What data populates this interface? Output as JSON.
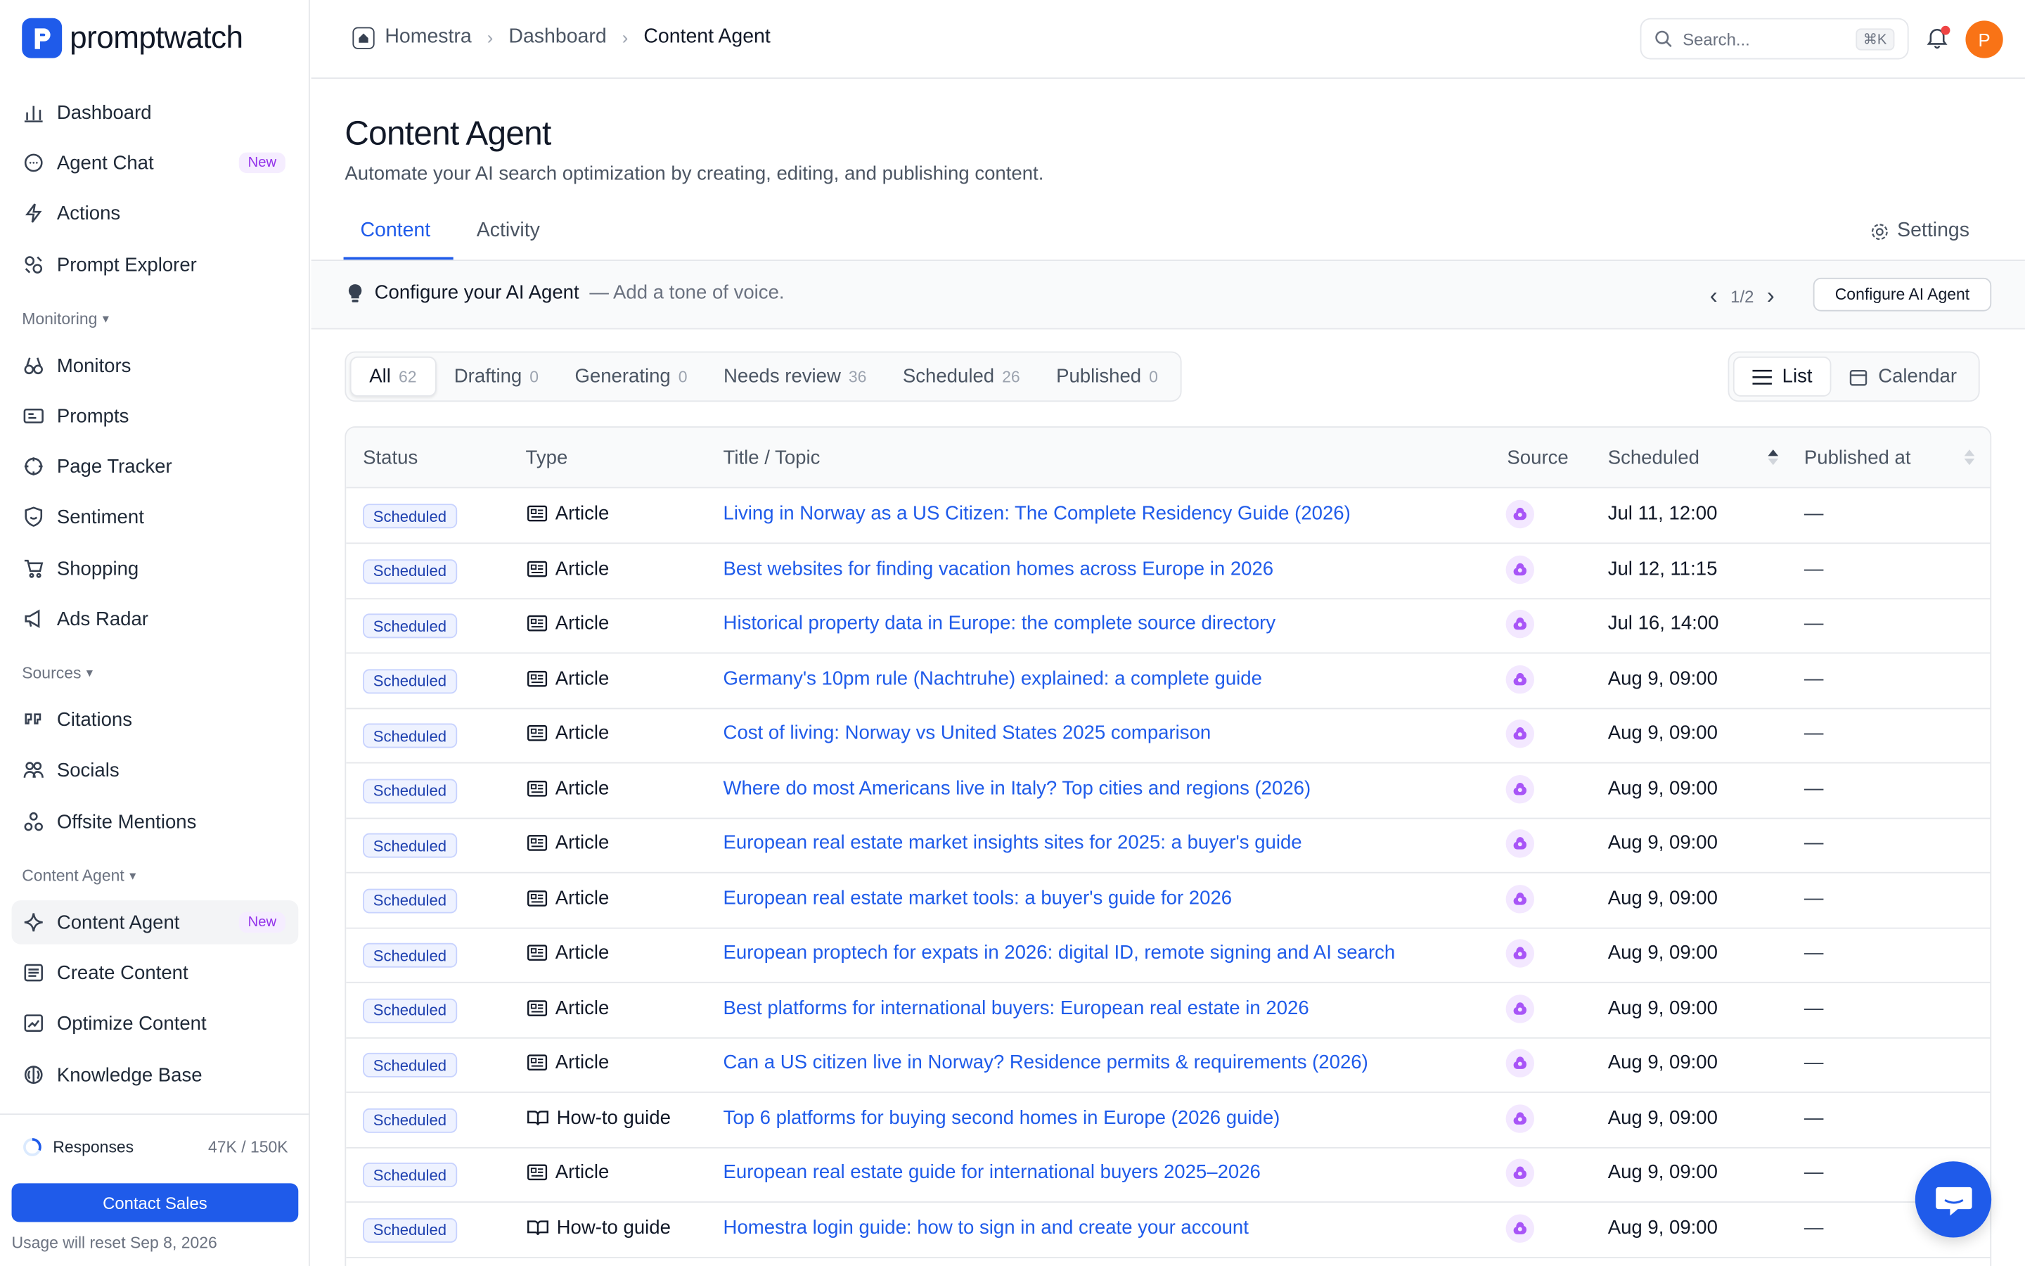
{
  "app": {
    "name": "promptwatch"
  },
  "sidebar": {
    "top_items": [
      {
        "label": "Dashboard",
        "icon": "bar-chart-icon"
      },
      {
        "label": "Agent Chat",
        "icon": "chat-icon",
        "badge": "New"
      },
      {
        "label": "Actions",
        "icon": "bolt-icon"
      },
      {
        "label": "Prompt Explorer",
        "icon": "explorer-icon"
      }
    ],
    "monitoring_label": "Monitoring",
    "monitoring_items": [
      {
        "label": "Monitors",
        "icon": "binoculars-icon"
      },
      {
        "label": "Prompts",
        "icon": "prompts-icon"
      },
      {
        "label": "Page Tracker",
        "icon": "crosshair-icon"
      },
      {
        "label": "Sentiment",
        "icon": "shield-smile-icon"
      },
      {
        "label": "Shopping",
        "icon": "cart-icon"
      },
      {
        "label": "Ads Radar",
        "icon": "megaphone-icon"
      }
    ],
    "sources_label": "Sources",
    "sources_items": [
      {
        "label": "Citations",
        "icon": "quote-icon"
      },
      {
        "label": "Socials",
        "icon": "users-icon"
      },
      {
        "label": "Offsite Mentions",
        "icon": "nodes-icon"
      }
    ],
    "content_label": "Content Agent",
    "content_items": [
      {
        "label": "Content Agent",
        "icon": "sparkle-icon",
        "badge": "New",
        "active": true
      },
      {
        "label": "Create Content",
        "icon": "document-icon"
      },
      {
        "label": "Optimize Content",
        "icon": "image-chart-icon"
      },
      {
        "label": "Knowledge Base",
        "icon": "brain-icon"
      }
    ],
    "usage": {
      "label": "Responses",
      "value": "47K / 150K",
      "fraction": 0.313
    },
    "contact_label": "Contact Sales",
    "reset_note": "Usage will reset Sep 8, 2026"
  },
  "header": {
    "breadcrumb": [
      "Homestra",
      "Dashboard",
      "Content Agent"
    ],
    "search_placeholder": "Search...",
    "search_shortcut": "⌘K",
    "avatar_initial": "P"
  },
  "page": {
    "title": "Content Agent",
    "subtitle": "Automate your AI search optimization by creating, editing, and publishing content.",
    "tabs": [
      "Content",
      "Activity"
    ],
    "settings_label": "Settings"
  },
  "banner": {
    "title": "Configure your AI Agent",
    "text": "— Add a tone of voice.",
    "pager": "1/2",
    "button": "Configure AI Agent"
  },
  "filters": [
    {
      "label": "All",
      "count": "62"
    },
    {
      "label": "Drafting",
      "count": "0"
    },
    {
      "label": "Generating",
      "count": "0"
    },
    {
      "label": "Needs review",
      "count": "36"
    },
    {
      "label": "Scheduled",
      "count": "26"
    },
    {
      "label": "Published",
      "count": "0"
    }
  ],
  "views": [
    "List",
    "Calendar"
  ],
  "table": {
    "columns": [
      "Status",
      "Type",
      "Title / Topic",
      "Source",
      "Scheduled",
      "Published at"
    ],
    "rows": [
      {
        "status": "Scheduled",
        "type": "Article",
        "title": "Living in Norway as a US Citizen: The Complete Residency Guide (2026)",
        "scheduled": "Jul 11, 12:00",
        "published": "—"
      },
      {
        "status": "Scheduled",
        "type": "Article",
        "title": "Best websites for finding vacation homes across Europe in 2026",
        "scheduled": "Jul 12, 11:15",
        "published": "—"
      },
      {
        "status": "Scheduled",
        "type": "Article",
        "title": "Historical property data in Europe: the complete source directory",
        "scheduled": "Jul 16, 14:00",
        "published": "—"
      },
      {
        "status": "Scheduled",
        "type": "Article",
        "title": "Germany's 10pm rule (Nachtruhe) explained: a complete guide",
        "scheduled": "Aug 9, 09:00",
        "published": "—"
      },
      {
        "status": "Scheduled",
        "type": "Article",
        "title": "Cost of living: Norway vs United States 2025 comparison",
        "scheduled": "Aug 9, 09:00",
        "published": "—"
      },
      {
        "status": "Scheduled",
        "type": "Article",
        "title": "Where do most Americans live in Italy? Top cities and regions (2026)",
        "scheduled": "Aug 9, 09:00",
        "published": "—"
      },
      {
        "status": "Scheduled",
        "type": "Article",
        "title": "European real estate market insights sites for 2025: a buyer's guide",
        "scheduled": "Aug 9, 09:00",
        "published": "—"
      },
      {
        "status": "Scheduled",
        "type": "Article",
        "title": "European real estate market tools: a buyer's guide for 2026",
        "scheduled": "Aug 9, 09:00",
        "published": "—"
      },
      {
        "status": "Scheduled",
        "type": "Article",
        "title": "European proptech for expats in 2026: digital ID, remote signing and AI search",
        "scheduled": "Aug 9, 09:00",
        "published": "—"
      },
      {
        "status": "Scheduled",
        "type": "Article",
        "title": "Best platforms for international buyers: European real estate in 2026",
        "scheduled": "Aug 9, 09:00",
        "published": "—"
      },
      {
        "status": "Scheduled",
        "type": "Article",
        "title": "Can a US citizen live in Norway? Residence permits & requirements (2026)",
        "scheduled": "Aug 9, 09:00",
        "published": "—"
      },
      {
        "status": "Scheduled",
        "type": "How-to guide",
        "title": "Top 6 platforms for buying second homes in Europe (2026 guide)",
        "scheduled": "Aug 9, 09:00",
        "published": "—"
      },
      {
        "status": "Scheduled",
        "type": "Article",
        "title": "European real estate guide for international buyers 2025–2026",
        "scheduled": "Aug 9, 09:00",
        "published": "—"
      },
      {
        "status": "Scheduled",
        "type": "How-to guide",
        "title": "Homestra login guide: how to sign in and create your account",
        "scheduled": "Aug 9, 09:00",
        "published": "—"
      }
    ]
  },
  "colors": {
    "accent": "#1f5bea",
    "badge_new": "#9333ea",
    "avatar": "#f97316"
  }
}
